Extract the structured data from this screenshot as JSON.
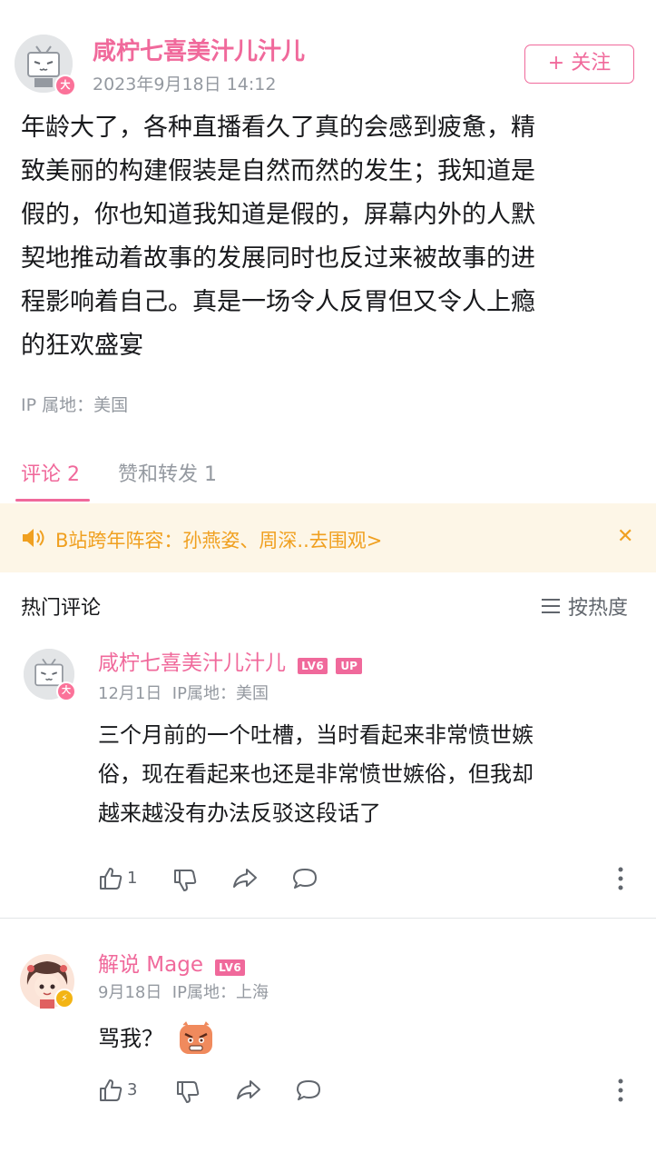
{
  "post": {
    "author": "咸柠七喜美汁儿汁儿",
    "time": "2023年9月18日 14:12",
    "follow_label": "+ 关注",
    "badge": "大",
    "content_lines": [
      "年龄大了，各种直播看久了真的会感到疲惫，精",
      "致美丽的构建假装是自然而然的发生；我知道是",
      "假的，你也知道我知道是假的，屏幕内外的人默",
      "契地推动着故事的发展同时也反过来被故事的进",
      "程影响着自己。真是一场令人反胃但又令人上瘾",
      "的狂欢盛宴"
    ],
    "ip": "IP 属地：美国"
  },
  "tabs": [
    {
      "label": "评论 2",
      "active": true
    },
    {
      "label": "赞和转发 1",
      "active": false
    }
  ],
  "notice": {
    "text": "B站跨年阵容：孙燕姿、周深..去围观>",
    "close_glyph": "✕"
  },
  "comments_header": {
    "title": "热门评论",
    "sort_label": "按热度"
  },
  "comments": [
    {
      "author": "咸柠七喜美汁儿汁儿",
      "level": "LV6",
      "up_badge": "UP",
      "meta": "12月1日  IP属地：美国",
      "text_lines": [
        "三个月前的一个吐槽，当时看起来非常愤世嫉",
        "俗，现在看起来也还是非常愤世嫉俗，但我却",
        "越来越没有办法反驳这段话了"
      ],
      "likes": "1"
    },
    {
      "author": "解说 Mage",
      "level": "LV6",
      "meta": "9月18日  IP属地：上海",
      "text_lines": [
        "骂我？"
      ],
      "likes": "3"
    }
  ],
  "colors": {
    "accent": "#f0699b",
    "notice_bg": "#fdf6e7",
    "notice_text": "#f0a020"
  }
}
